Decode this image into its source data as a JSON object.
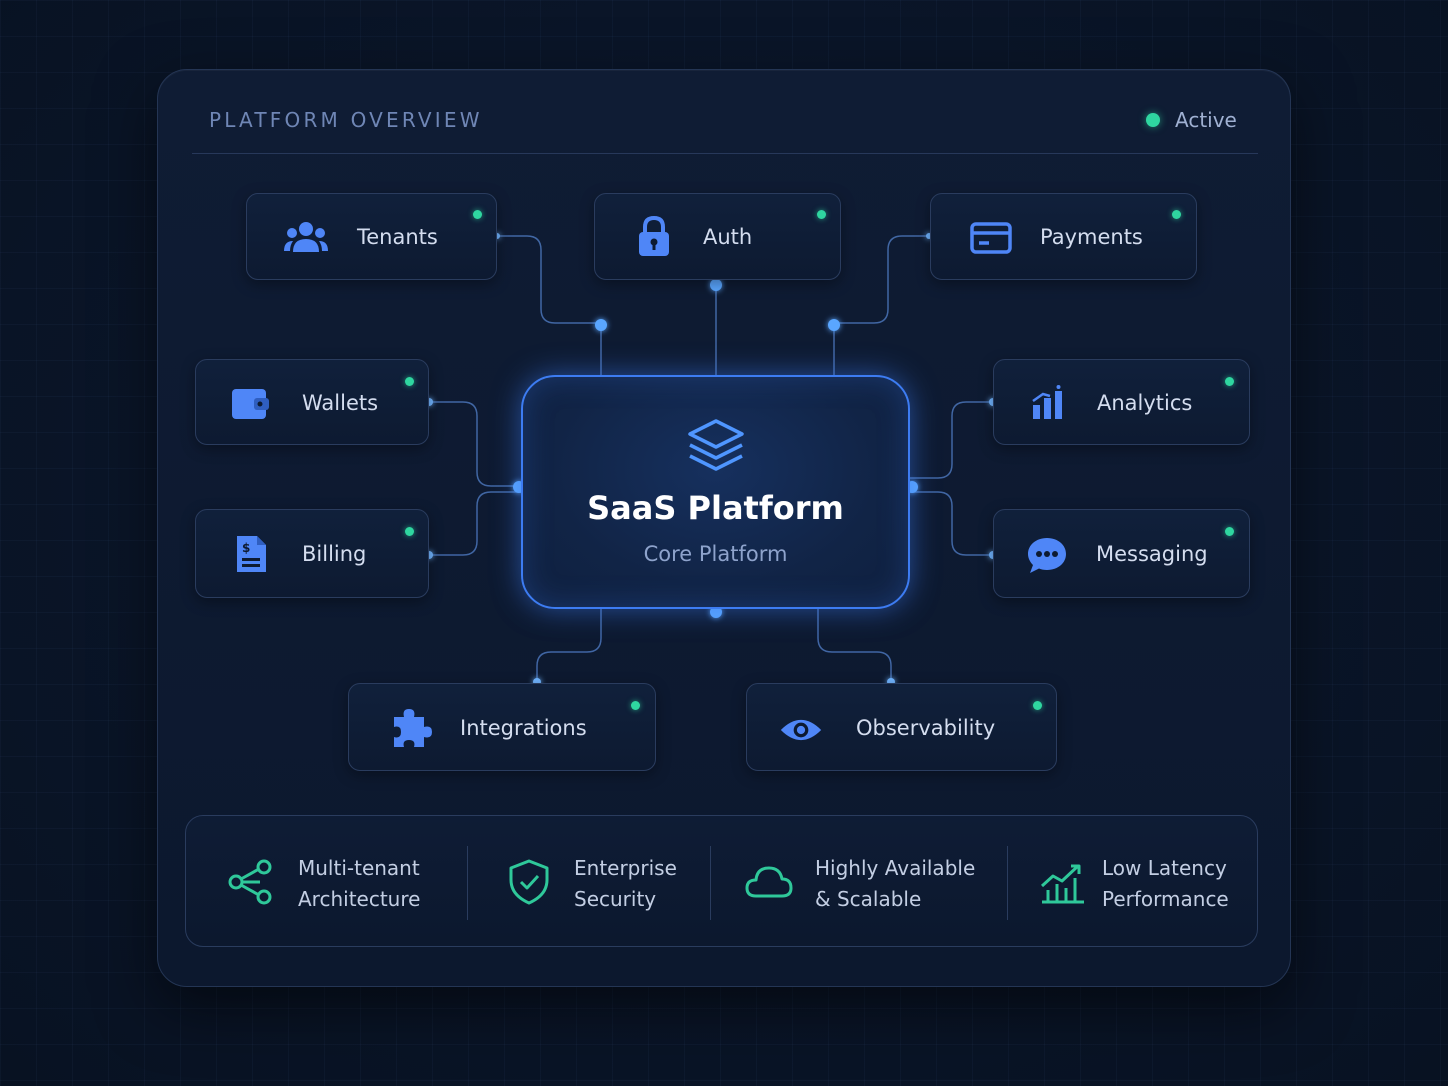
{
  "header": {
    "title": "PLATFORM OVERVIEW",
    "status_label": "Active",
    "status_color": "#2fd6a0"
  },
  "core": {
    "title": "SaaS Platform",
    "subtitle": "Core Platform",
    "icon": "layers-icon",
    "accent": "#3d7cf2"
  },
  "modules": [
    {
      "label": "Tenants",
      "icon": "users-icon",
      "status": "active"
    },
    {
      "label": "Auth",
      "icon": "lock-icon",
      "status": "active"
    },
    {
      "label": "Payments",
      "icon": "credit-card-icon",
      "status": "active"
    },
    {
      "label": "Wallets",
      "icon": "wallet-icon",
      "status": "active"
    },
    {
      "label": "Billing",
      "icon": "invoice-icon",
      "status": "active"
    },
    {
      "label": "Analytics",
      "icon": "bar-chart-icon",
      "status": "active"
    },
    {
      "label": "Messaging",
      "icon": "chat-bubble-icon",
      "status": "active"
    },
    {
      "label": "Integrations",
      "icon": "puzzle-icon",
      "status": "active"
    },
    {
      "label": "Observability",
      "icon": "eye-icon",
      "status": "active"
    }
  ],
  "features": [
    {
      "line1": "Multi-tenant",
      "line2": "Architecture",
      "icon": "share-nodes-icon"
    },
    {
      "line1": "Enterprise",
      "line2": "Security",
      "icon": "shield-check-icon"
    },
    {
      "line1": "Highly Available",
      "line2": "& Scalable",
      "icon": "cloud-icon"
    },
    {
      "line1": "Low Latency",
      "line2": "Performance",
      "icon": "trend-chart-icon"
    }
  ],
  "colors": {
    "module_icon": "#4f86f7",
    "feature_icon": "#2fc89a",
    "connector": "#5c8fe0",
    "background": "#0a1528"
  }
}
